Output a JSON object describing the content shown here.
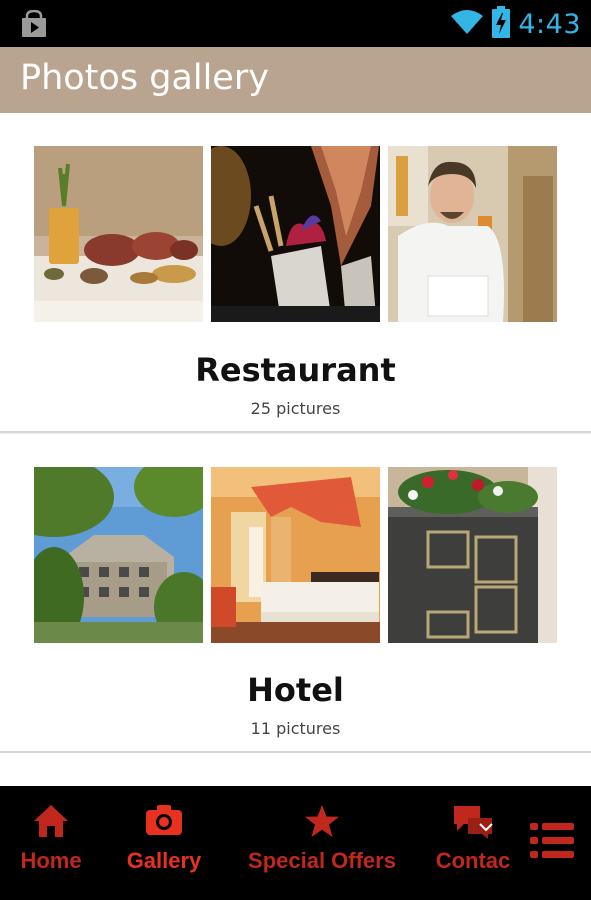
{
  "status_bar": {
    "time": "4:43",
    "icons": [
      "shopping-bag-icon",
      "wifi-icon",
      "battery-charging-icon"
    ],
    "time_color": "#33b5e5"
  },
  "header": {
    "title": "Photos gallery",
    "background": "#b8a48f"
  },
  "albums": [
    {
      "name": "Restaurant",
      "count": "25 pictures",
      "thumbnails": [
        "plated-meat-dish-photo",
        "dessert-in-glass-photo",
        "chef-portrait-photo"
      ]
    },
    {
      "name": "Hotel",
      "count": "11 pictures",
      "thumbnails": [
        "hotel-building-exterior-photo",
        "bedroom-photo",
        "antique-stove-with-flowers-photo"
      ]
    }
  ],
  "bottom_nav": {
    "accent": "#c0281d",
    "active": "Gallery",
    "items": [
      {
        "label": "Home",
        "icon": "home-icon"
      },
      {
        "label": "Gallery",
        "icon": "camera-icon"
      },
      {
        "label": "Special Offers",
        "icon": "star-icon"
      },
      {
        "label": "Contac",
        "icon": "chat-bubbles-icon"
      }
    ],
    "more_icon": "list-menu-icon"
  }
}
